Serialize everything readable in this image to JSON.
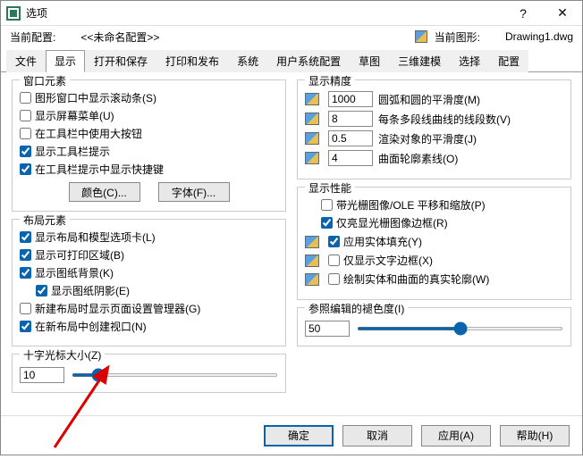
{
  "window": {
    "title": "选项",
    "help": "?",
    "close": "✕"
  },
  "info": {
    "current_config_label": "当前配置:",
    "current_config_value": "<<未命名配置>>",
    "current_drawing_label": "当前图形:",
    "current_drawing_value": "Drawing1.dwg"
  },
  "tabs": [
    "文件",
    "显示",
    "打开和保存",
    "打印和发布",
    "系统",
    "用户系统配置",
    "草图",
    "三维建模",
    "选择",
    "配置"
  ],
  "active_tab": 1,
  "win_elements": {
    "title": "窗口元素",
    "scrollbars": "图形窗口中显示滚动条(S)",
    "screen_menu": "显示屏幕菜单(U)",
    "large_buttons": "在工具栏中使用大按钮",
    "tooltips": "显示工具栏提示",
    "shortcuts": "在工具栏提示中显示快捷键",
    "color_btn": "颜色(C)...",
    "font_btn": "字体(F)..."
  },
  "layout_elements": {
    "title": "布局元素",
    "tabs": "显示布局和模型选项卡(L)",
    "printable": "显示可打印区域(B)",
    "paper_bg": "显示图纸背景(K)",
    "paper_shadow": "显示图纸阴影(E)",
    "page_setup": "新建布局时显示页面设置管理器(G)",
    "viewport": "在新布局中创建视口(N)"
  },
  "crosshair": {
    "title": "十字光标大小(Z)",
    "value": "10"
  },
  "precision": {
    "title": "显示精度",
    "arc": {
      "value": "1000",
      "label": "圆弧和圆的平滑度(M)"
    },
    "segments": {
      "value": "8",
      "label": "每条多段线曲线的线段数(V)"
    },
    "render": {
      "value": "0.5",
      "label": "渲染对象的平滑度(J)"
    },
    "contour": {
      "value": "4",
      "label": "曲面轮廓素线(O)"
    }
  },
  "performance": {
    "title": "显示性能",
    "raster": "带光栅图像/OLE 平移和缩放(P)",
    "highlight": "仅亮显光栅图像边框(R)",
    "solid_fill": "应用实体填充(Y)",
    "text_frame": "仅显示文字边框(X)",
    "silhouette": "绘制实体和曲面的真实轮廓(W)"
  },
  "fade": {
    "title": "参照编辑的褪色度(I)",
    "value": "50"
  },
  "footer": {
    "ok": "确定",
    "cancel": "取消",
    "apply": "应用(A)",
    "help": "帮助(H)"
  }
}
